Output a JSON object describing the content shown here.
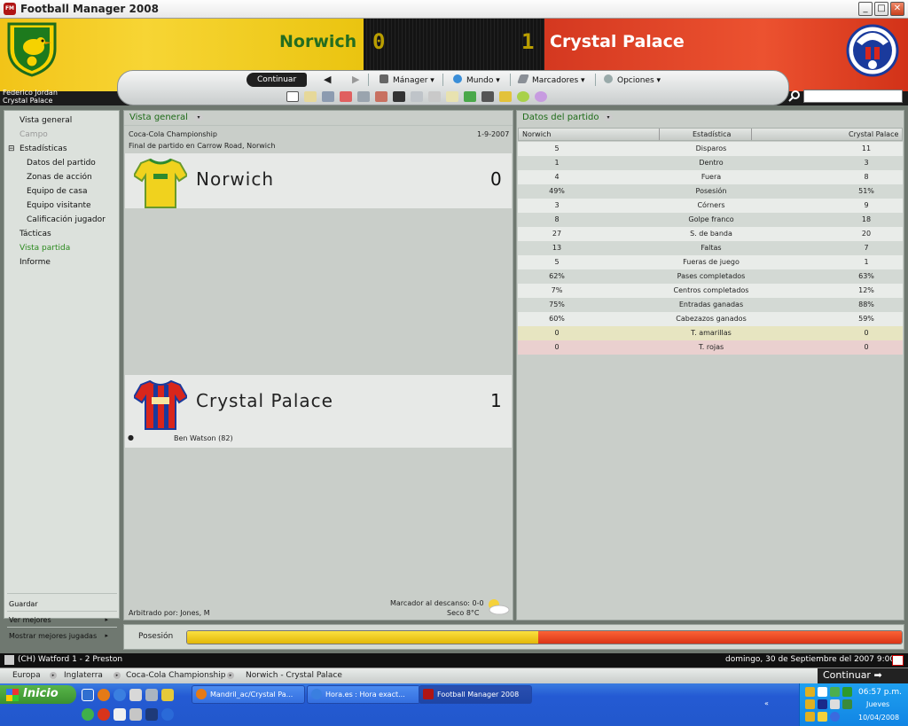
{
  "window": {
    "title": "Football Manager 2008",
    "min": "_",
    "max": "□",
    "close": "✕",
    "app_icon": "FM"
  },
  "scoreboard": {
    "home_team": "Norwich",
    "away_team": "Crystal Palace",
    "home_score": "0",
    "away_score": "1",
    "manager_name": "Federico Jordan",
    "manager_club": "Crystal Palace",
    "colors": {
      "home": "#f2c418",
      "away": "#e3421f"
    }
  },
  "toolbar": {
    "continue_label": "Continuar",
    "back_arrow": "◀",
    "forward_arrow": "▶",
    "menus": [
      "Mánager ▾",
      "Mundo ▾",
      "Marcadores ▾",
      "Opciones ▾"
    ],
    "icons": [
      "home-icon",
      "ball-icon",
      "news-icon",
      "calendar-icon",
      "people-icon",
      "boot-icon",
      "board-icon",
      "trophy-icon",
      "whistle-icon",
      "notes-icon",
      "pitch-icon",
      "binoculars-icon",
      "clubs-icon",
      "help-icon",
      "question-icon"
    ],
    "search_placeholder": ""
  },
  "sidebar": {
    "items": [
      {
        "label": "Vista general"
      },
      {
        "label": "Campo"
      },
      {
        "label": "Estadísticas"
      },
      {
        "label": "Datos del partido"
      },
      {
        "label": "Zonas de acción"
      },
      {
        "label": "Equipo de casa"
      },
      {
        "label": "Equipo visitante"
      },
      {
        "label": "Calificación jugador"
      },
      {
        "label": "Tácticas"
      },
      {
        "label": "Vista partida"
      },
      {
        "label": "Informe"
      }
    ],
    "expand_glyph": "⊟",
    "bottom": {
      "save": "Guardar",
      "best": "Ver mejores",
      "best_plays": "Mostrar mejores jugadas",
      "arrow": "▸"
    }
  },
  "overview": {
    "title": "Vista general",
    "competition": "Coca-Cola Championship",
    "date": "1-9-2007",
    "venue": "Final de partido en Carrow Road, Norwich",
    "home_team": "Norwich",
    "home_score": "0",
    "away_team": "Crystal Palace",
    "away_score": "1",
    "scorer": "Ben Watson (82)",
    "scorer_icon": "●",
    "half_time": "Marcador al descanso: 0-0",
    "weather": "Seco 8°C",
    "referee": "Arbitrado por: Jones, M"
  },
  "match_stats": {
    "title": "Datos del partido",
    "headers": {
      "home": "Norwich",
      "stat": "Estadística",
      "away": "Crystal Palace"
    },
    "rows": [
      {
        "h": "5",
        "l": "Disparos",
        "a": "11"
      },
      {
        "h": "1",
        "l": "Dentro",
        "a": "3"
      },
      {
        "h": "4",
        "l": "Fuera",
        "a": "8"
      },
      {
        "h": "49%",
        "l": "Posesión",
        "a": "51%"
      },
      {
        "h": "3",
        "l": "Córners",
        "a": "9"
      },
      {
        "h": "8",
        "l": "Golpe franco",
        "a": "18"
      },
      {
        "h": "27",
        "l": "S. de banda",
        "a": "20"
      },
      {
        "h": "13",
        "l": "Faltas",
        "a": "7"
      },
      {
        "h": "5",
        "l": "Fueras de juego",
        "a": "1"
      },
      {
        "h": "62%",
        "l": "Pases completados",
        "a": "63%"
      },
      {
        "h": "7%",
        "l": "Centros completados",
        "a": "12%"
      },
      {
        "h": "75%",
        "l": "Entradas ganadas",
        "a": "88%"
      },
      {
        "h": "60%",
        "l": "Cabezazos ganados",
        "a": "59%"
      },
      {
        "h": "0",
        "l": "T. amarillas",
        "a": "0"
      },
      {
        "h": "0",
        "l": "T. rojas",
        "a": "0"
      }
    ]
  },
  "possession": {
    "label": "Posesión",
    "home": 49,
    "away": 51
  },
  "ticker": {
    "text": "(CH) Watford 1 - 2 Preston",
    "datetime": "domingo, 30 de Septiembre del 2007 9:00"
  },
  "breadcrumbs": {
    "items": [
      "Europa",
      "Inglaterra",
      "Coca-Cola Championship",
      "Norwich - Crystal Palace"
    ],
    "arrow": "▸",
    "continue": "Continuar ➡"
  },
  "taskbar": {
    "start": "Inicio",
    "tasks": [
      "Mandril_ac/Crystal Pa...",
      "Hora.es : Hora exact...",
      "Football Manager 2008"
    ],
    "expand": "«",
    "time": "06:57 p.m.",
    "day": "Jueves",
    "date": "10/04/2008"
  }
}
